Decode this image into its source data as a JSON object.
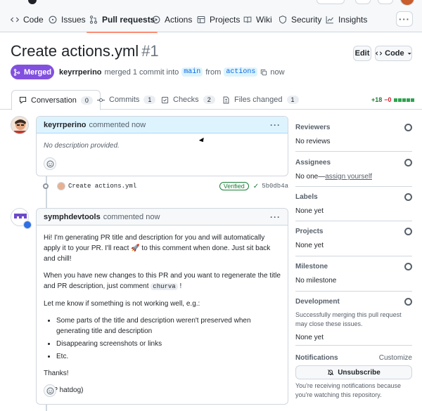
{
  "nav": {
    "items": [
      {
        "label": "Code",
        "icon": "code-icon"
      },
      {
        "label": "Issues",
        "icon": "issue-icon"
      },
      {
        "label": "Pull requests",
        "icon": "pull-request-icon"
      },
      {
        "label": "Actions",
        "icon": "play-icon"
      },
      {
        "label": "Projects",
        "icon": "table-icon"
      },
      {
        "label": "Wiki",
        "icon": "book-icon"
      },
      {
        "label": "Security",
        "icon": "shield-icon"
      },
      {
        "label": "Insights",
        "icon": "graph-icon"
      }
    ],
    "more": "···"
  },
  "pr": {
    "title": "Create actions.yml",
    "number": "#1",
    "edit_label": "Edit",
    "code_label": "Code",
    "state": "Merged",
    "author": "keyrrperino",
    "merge_text": "merged 1 commit into",
    "base_branch": "main",
    "from_text": "from",
    "head_branch": "actions",
    "time": "now"
  },
  "tabs": [
    {
      "label": "Conversation",
      "count": "0",
      "icon": "comment-icon"
    },
    {
      "label": "Commits",
      "count": "1",
      "icon": "commit-icon"
    },
    {
      "label": "Checks",
      "count": "2",
      "icon": "checklist-icon"
    },
    {
      "label": "Files changed",
      "count": "1",
      "icon": "file-diff-icon"
    }
  ],
  "diffstat": {
    "additions": "+18",
    "deletions": "−0"
  },
  "comment1": {
    "author": "keyrrperino",
    "action": "commented now",
    "body": "No description provided."
  },
  "commit": {
    "message": "Create actions.yml",
    "badge": "Verified",
    "sha": "5b0db4a"
  },
  "comment2": {
    "author": "symphdevtools",
    "action": "commented now",
    "p1_a": "Hi! I'm generating PR title and description for you and will automatically apply it to your PR. I'll react",
    "p1_b": "to this comment when done. Just sit back and chill!",
    "p2_a": "When you have new changes to this PR and you want to regenerate the title and PR description, just comment",
    "p2_code": "churva",
    "p2_b": "!",
    "p3": "Let me know if something is not working well, e.g.:",
    "bullets": [
      "Some parts of the title and description weren't preserved when generating title and description",
      "Disappearing screenshots or links",
      "Etc."
    ],
    "thanks": "Thanks!",
    "sign": "(RIP hatdog)"
  },
  "sidebar": {
    "reviewers": {
      "title": "Reviewers",
      "value": "No reviews"
    },
    "assignees": {
      "title": "Assignees",
      "value_prefix": "No one—",
      "link": "assign yourself"
    },
    "labels": {
      "title": "Labels",
      "value": "None yet"
    },
    "projects": {
      "title": "Projects",
      "value": "None yet"
    },
    "milestone": {
      "title": "Milestone",
      "value": "No milestone"
    },
    "development": {
      "title": "Development",
      "desc": "Successfully merging this pull request may close these issues.",
      "value": "None yet"
    },
    "notifications": {
      "title": "Notifications",
      "customize": "Customize",
      "button": "Unsubscribe",
      "desc": "You're receiving notifications because you're watching this repository."
    }
  }
}
